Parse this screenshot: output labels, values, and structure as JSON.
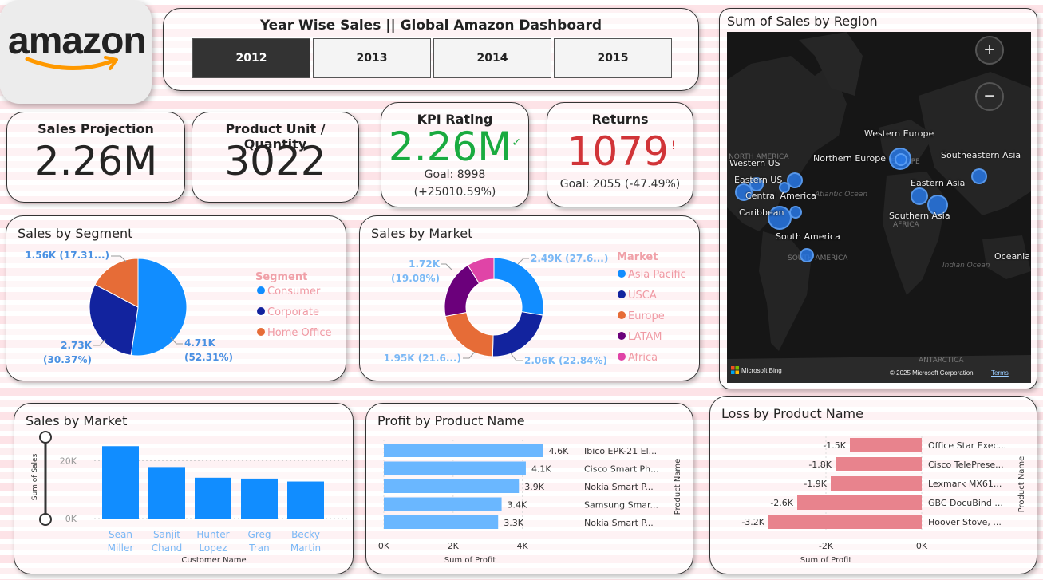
{
  "logo": {
    "text": "amazon"
  },
  "year_slicer": {
    "title": "Year Wise Sales || Global Amazon Dashboard",
    "years": [
      "2012",
      "2013",
      "2014",
      "2015"
    ],
    "selected": "2012"
  },
  "kpis": {
    "sales_projection": {
      "title": "Sales Projection",
      "value": "2.26M"
    },
    "product_units": {
      "title": "Product Unit / Quantity",
      "value": "3022"
    },
    "kpi_rating": {
      "title": "KPI Rating",
      "value": "2.26M",
      "check": "✓",
      "goal": "Goal: 8998",
      "delta": "(+25010.59%)",
      "color": "#1aab40"
    },
    "returns": {
      "title": "Returns",
      "value": "1079",
      "mark": "!",
      "goal": "Goal: 2055 (-47.49%)",
      "color": "#d13438"
    }
  },
  "segment_chart": {
    "title": "Sales by Segment",
    "legend_title": "Segment",
    "slices": [
      {
        "name": "Consumer",
        "label": "4.71K",
        "pct": "(52.31%)",
        "share": 52.31,
        "color": "#118dff"
      },
      {
        "name": "Corporate",
        "label": "2.73K",
        "pct": "(30.37%)",
        "share": 30.37,
        "color": "#12239e"
      },
      {
        "name": "Home Office",
        "label": "1.56K (17.31...)",
        "pct": "",
        "share": 17.31,
        "color": "#e66c37"
      }
    ]
  },
  "market_chart": {
    "title": "Sales by Market",
    "legend_title": "Market",
    "slices": [
      {
        "name": "Asia Pacific",
        "label": "2.49K (27.6...)",
        "share": 27.6,
        "color": "#118dff"
      },
      {
        "name": "USCA",
        "label": "2.06K (22.84%)",
        "share": 22.84,
        "color": "#12239e"
      },
      {
        "name": "Europe",
        "label": "1.95K (21.6...)",
        "share": 21.6,
        "color": "#e66c37"
      },
      {
        "name": "LATAM",
        "label": "1.72K",
        "label2": "(19.08%)",
        "share": 19.08,
        "color": "#6b007b"
      },
      {
        "name": "Africa",
        "label": "",
        "share": 8.88,
        "color": "#e044a7"
      }
    ]
  },
  "map": {
    "title": "Sum of Sales by Region",
    "zoom_in": "+",
    "zoom_out": "−",
    "attribution": "© 2025 Microsoft Corporation",
    "terms": "Terms",
    "bing": "Microsoft Bing",
    "regions": [
      "Western Europe",
      "Northern Europe",
      "Southeastern Asia",
      "Western US",
      "Eastern US",
      "Central America",
      "Eastern Asia",
      "Caribbean",
      "Southern Asia",
      "South America",
      "Oceania"
    ],
    "geo_labels": [
      "NORTH AMERICA",
      "EUROPE",
      "AFRICA",
      "SOUTH AMERICA",
      "ANTARCTICA"
    ],
    "ocean_labels": [
      "Atlantic Ocean",
      "Indian Ocean"
    ]
  },
  "customer_chart": {
    "title": "Sales by Market",
    "ylabel": "Sum of Sales",
    "xlabel": "Customer Name",
    "yticks": [
      "0K",
      "20K"
    ],
    "chart_data": {
      "type": "bar",
      "categories": [
        "Sean Miller",
        "Sanjit Chand",
        "Hunter Lopez",
        "Greg Tran",
        "Becky Martin"
      ],
      "category_lines": [
        [
          "Sean",
          "Miller"
        ],
        [
          "Sanjit",
          "Chand"
        ],
        [
          "Hunter",
          "Lopez"
        ],
        [
          "Greg",
          "Tran"
        ],
        [
          "Becky",
          "Martin"
        ]
      ],
      "values": [
        25000,
        17800,
        14100,
        13800,
        12800
      ],
      "ylim": [
        0,
        27000
      ],
      "color": "#118dff"
    }
  },
  "profit_chart": {
    "title": "Profit by Product Name",
    "xlabel": "Sum of Profit",
    "ylabel": "Product Name",
    "xticks": [
      "0K",
      "2K",
      "4K"
    ],
    "chart_data": {
      "type": "bar",
      "categories": [
        "Ibico EPK-21 El...",
        "Cisco Smart Ph...",
        "Nokia Smart P...",
        "Samsung Smar...",
        "Nokia Smart P..."
      ],
      "values": [
        4.6,
        4.1,
        3.9,
        3.4,
        3.3
      ],
      "value_labels": [
        "4.6K",
        "4.1K",
        "3.9K",
        "3.4K",
        "3.3K"
      ],
      "xlim": [
        0,
        5
      ],
      "color": "#6ab7ff"
    }
  },
  "loss_chart": {
    "title": "Loss by Product Name",
    "xlabel": "Sum of Profit",
    "ylabel": "Product Name",
    "xticks": [
      "-2K",
      "0K"
    ],
    "chart_data": {
      "type": "bar",
      "categories": [
        "Office Star Exec...",
        "Cisco TelePrese...",
        "Lexmark MX61...",
        "GBC DocuBind ...",
        "Hoover Stove, ..."
      ],
      "values": [
        -1.5,
        -1.8,
        -1.9,
        -2.6,
        -3.2
      ],
      "value_labels": [
        "-1.5K",
        "-1.8K",
        "-1.9K",
        "-2.6K",
        "-3.2K"
      ],
      "xlim": [
        -3.3,
        0
      ],
      "color": "#e8838d"
    }
  }
}
